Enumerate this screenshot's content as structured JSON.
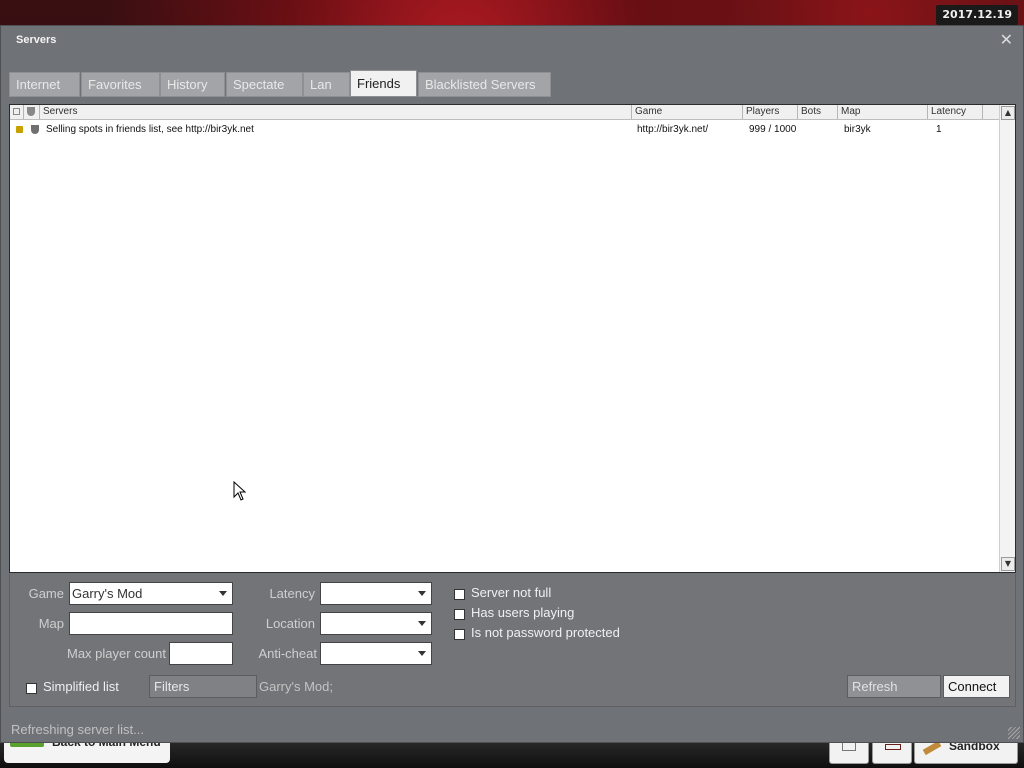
{
  "date_badge": "2017.12.19",
  "window": {
    "title": "Servers"
  },
  "tabs": [
    {
      "label": "Internet",
      "active": false
    },
    {
      "label": "Favorites",
      "active": false
    },
    {
      "label": "History",
      "active": false
    },
    {
      "label": "Spectate",
      "active": false
    },
    {
      "label": "Lan",
      "active": false
    },
    {
      "label": "Friends",
      "active": true
    },
    {
      "label": "Blacklisted Servers",
      "active": false
    }
  ],
  "columns": {
    "servers": "Servers",
    "game": "Game",
    "players": "Players",
    "bots": "Bots",
    "map": "Map",
    "latency": "Latency"
  },
  "rows": [
    {
      "server": "Selling spots in friends list, see http://bir3yk.net",
      "game": "http://bir3yk.net/",
      "players": "999 / 1000",
      "bots": "",
      "map": "bir3yk",
      "latency": "1",
      "locked": true
    }
  ],
  "filters": {
    "game_label": "Game",
    "game_value": "Garry's Mod",
    "map_label": "Map",
    "map_value": "",
    "max_player_label": "Max player count",
    "max_player_value": "",
    "latency_label": "Latency",
    "latency_value": "",
    "location_label": "Location",
    "location_value": "",
    "anticheat_label": "Anti-cheat",
    "anticheat_value": "",
    "server_not_full": "Server not full",
    "has_users": "Has users playing",
    "not_password": "Is not password protected"
  },
  "bottom": {
    "simplified_label": "Simplified list",
    "filters_button": "Filters",
    "filter_summary": "Garry's Mod;",
    "refresh_button": "Refresh",
    "connect_button": "Connect"
  },
  "status_text": "Refreshing server list...",
  "bg": {
    "main_menu_label": "Back to Main Menu",
    "sandbox_label": "Sandbox"
  },
  "colors": {
    "window_bg": "#6f7276",
    "list_bg": "#ffffff",
    "accent_lock": "#c8a000"
  }
}
